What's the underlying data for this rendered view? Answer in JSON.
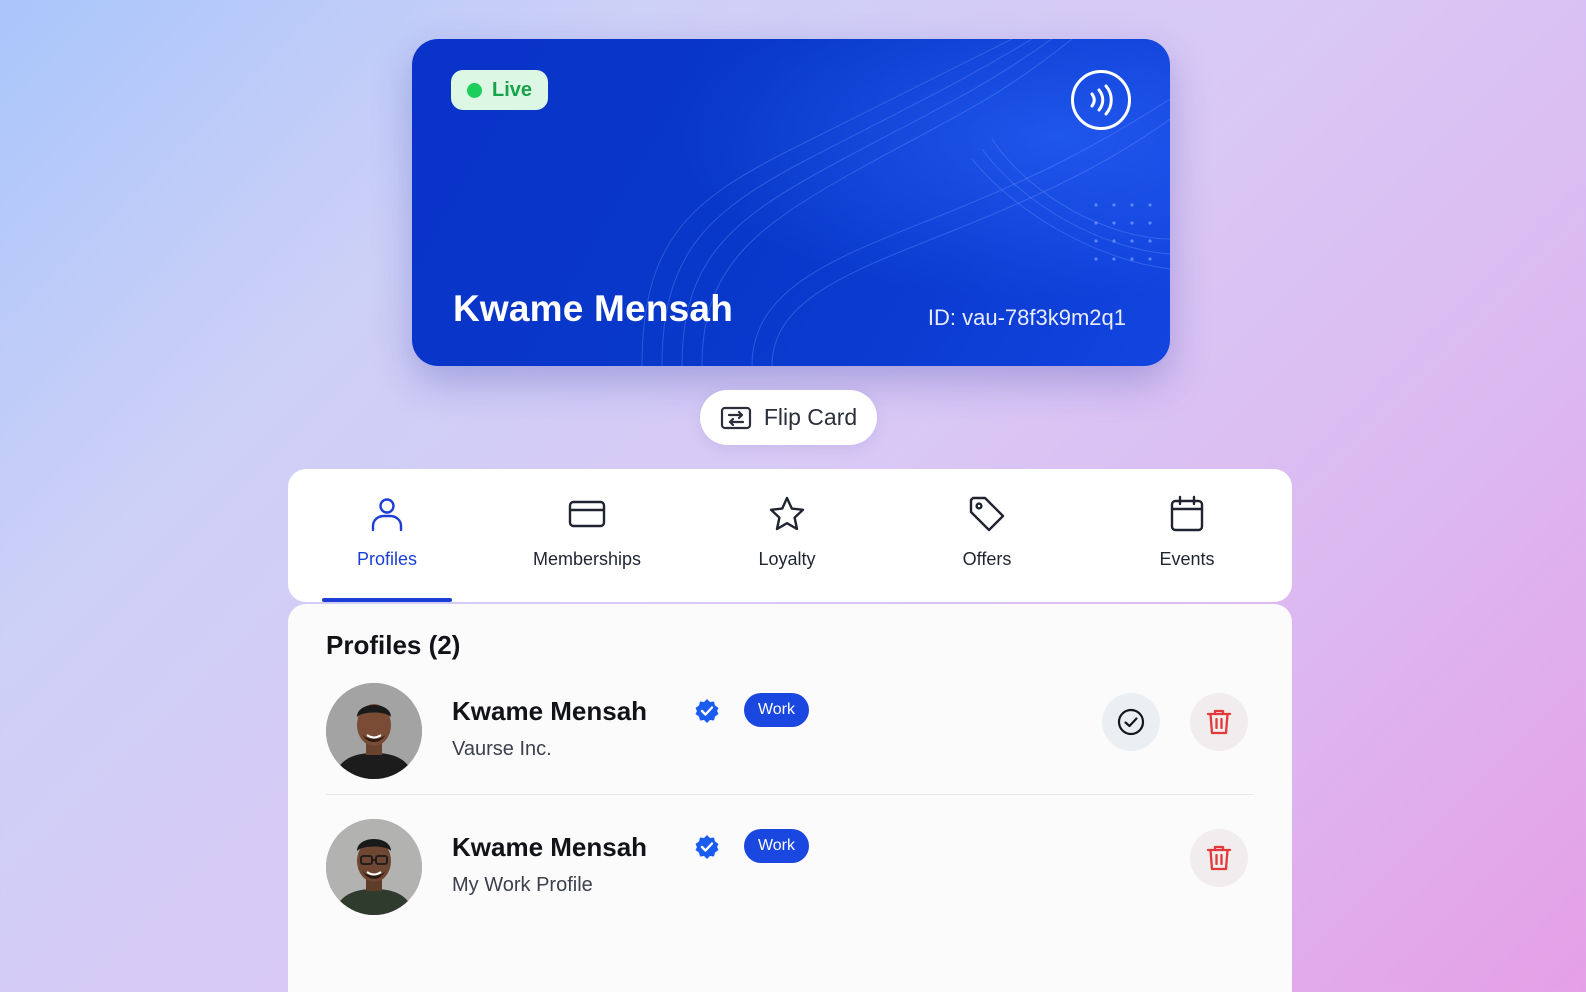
{
  "card": {
    "status": "Live",
    "holder_name": "Kwame Mensah",
    "id_text": "ID: vau-78f3k9m2q1",
    "colors": {
      "background": "#0a33c9",
      "status_badge_bg": "#dcf7e3",
      "status_dot": "#1ccf5c"
    },
    "icons": [
      "contactless-icon"
    ]
  },
  "flip": {
    "label": "Flip Card",
    "icon": "flip-card-icon"
  },
  "tabs": [
    {
      "label": "Profiles",
      "icon": "user-icon",
      "active": true
    },
    {
      "label": "Memberships",
      "icon": "card-icon",
      "active": false
    },
    {
      "label": "Loyalty",
      "icon": "star-icon",
      "active": false
    },
    {
      "label": "Offers",
      "icon": "tag-icon",
      "active": false
    },
    {
      "label": "Events",
      "icon": "calendar-icon",
      "active": false
    }
  ],
  "accent_color": "#1b3ed6",
  "profiles": {
    "title": "Profiles (2)",
    "items": [
      {
        "name": "Kwame Mensah",
        "verified": true,
        "badge": "Work",
        "subtitle": "Vaurse Inc.",
        "actions": [
          "select",
          "delete"
        ]
      },
      {
        "name": "Kwame Mensah",
        "verified": true,
        "badge": "Work",
        "subtitle": "My Work Profile",
        "actions": [
          "delete"
        ]
      }
    ]
  }
}
